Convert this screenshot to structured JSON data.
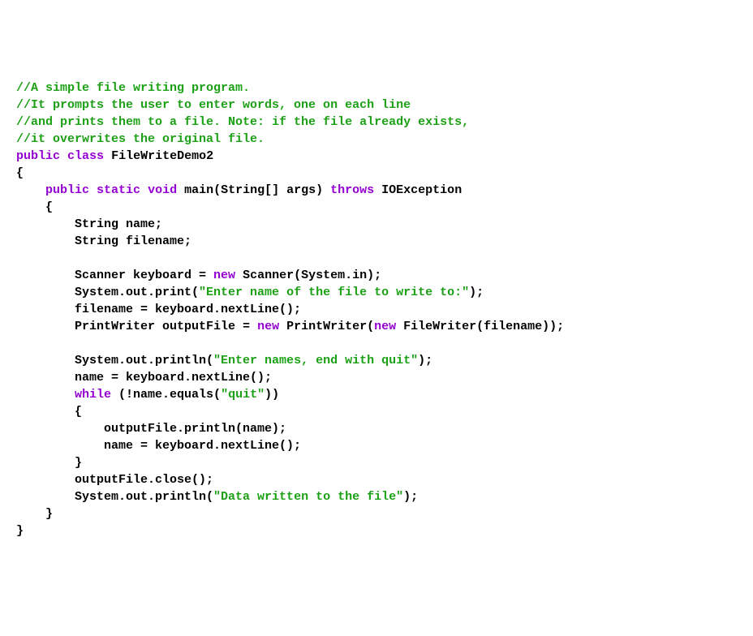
{
  "code": {
    "lines": [
      [
        {
          "t": "//A simple file writing program.",
          "c": "comment"
        }
      ],
      [
        {
          "t": "//It prompts the user to enter words, one on each line",
          "c": "comment"
        }
      ],
      [
        {
          "t": "//and prints them to a file. Note: if the file already exists,",
          "c": "comment"
        }
      ],
      [
        {
          "t": "//it overwrites the original file.",
          "c": "comment"
        }
      ],
      [
        {
          "t": "public",
          "c": "keyword"
        },
        {
          "t": " ",
          "c": "plain"
        },
        {
          "t": "class",
          "c": "keyword"
        },
        {
          "t": " ",
          "c": "plain"
        },
        {
          "t": "FileWriteDemo2",
          "c": "class"
        }
      ],
      [
        {
          "t": "{",
          "c": "plain"
        }
      ],
      [
        {
          "t": "    ",
          "c": "plain"
        },
        {
          "t": "public",
          "c": "keyword"
        },
        {
          "t": " ",
          "c": "plain"
        },
        {
          "t": "static",
          "c": "keyword"
        },
        {
          "t": " ",
          "c": "plain"
        },
        {
          "t": "void",
          "c": "keyword"
        },
        {
          "t": " ",
          "c": "plain"
        },
        {
          "t": "main",
          "c": "method"
        },
        {
          "t": "(String[] args) ",
          "c": "plain"
        },
        {
          "t": "throws",
          "c": "keyword"
        },
        {
          "t": " IOException",
          "c": "plain"
        }
      ],
      [
        {
          "t": "    {",
          "c": "plain"
        }
      ],
      [
        {
          "t": "        String name;",
          "c": "plain"
        }
      ],
      [
        {
          "t": "        String filename;",
          "c": "plain"
        }
      ],
      [
        {
          "t": "",
          "c": "plain"
        }
      ],
      [
        {
          "t": "        Scanner keyboard = ",
          "c": "plain"
        },
        {
          "t": "new",
          "c": "keyword"
        },
        {
          "t": " Scanner(System.in);",
          "c": "plain"
        }
      ],
      [
        {
          "t": "        System.out.print(",
          "c": "plain"
        },
        {
          "t": "\"Enter name of the file to write to:\"",
          "c": "string"
        },
        {
          "t": ");",
          "c": "plain"
        }
      ],
      [
        {
          "t": "        filename = keyboard.nextLine();",
          "c": "plain"
        }
      ],
      [
        {
          "t": "        PrintWriter outputFile = ",
          "c": "plain"
        },
        {
          "t": "new",
          "c": "keyword"
        },
        {
          "t": " PrintWriter(",
          "c": "plain"
        },
        {
          "t": "new",
          "c": "keyword"
        },
        {
          "t": " FileWriter(filename));",
          "c": "plain"
        }
      ],
      [
        {
          "t": "",
          "c": "plain"
        }
      ],
      [
        {
          "t": "        System.out.println(",
          "c": "plain"
        },
        {
          "t": "\"Enter names, end with quit\"",
          "c": "string"
        },
        {
          "t": ");",
          "c": "plain"
        }
      ],
      [
        {
          "t": "        name = keyboard.nextLine();",
          "c": "plain"
        }
      ],
      [
        {
          "t": "        ",
          "c": "plain"
        },
        {
          "t": "while",
          "c": "keyword"
        },
        {
          "t": " (!name.equals(",
          "c": "plain"
        },
        {
          "t": "\"quit\"",
          "c": "string"
        },
        {
          "t": "))",
          "c": "plain"
        }
      ],
      [
        {
          "t": "        {",
          "c": "plain"
        }
      ],
      [
        {
          "t": "            outputFile.println(name);",
          "c": "plain"
        }
      ],
      [
        {
          "t": "            name = keyboard.nextLine();",
          "c": "plain"
        }
      ],
      [
        {
          "t": "        }",
          "c": "plain"
        }
      ],
      [
        {
          "t": "        outputFile.close();",
          "c": "plain"
        }
      ],
      [
        {
          "t": "        System.out.println(",
          "c": "plain"
        },
        {
          "t": "\"Data written to the file\"",
          "c": "string"
        },
        {
          "t": ");",
          "c": "plain"
        }
      ],
      [
        {
          "t": "    }",
          "c": "plain"
        }
      ],
      [
        {
          "t": "}",
          "c": "plain"
        }
      ]
    ]
  }
}
